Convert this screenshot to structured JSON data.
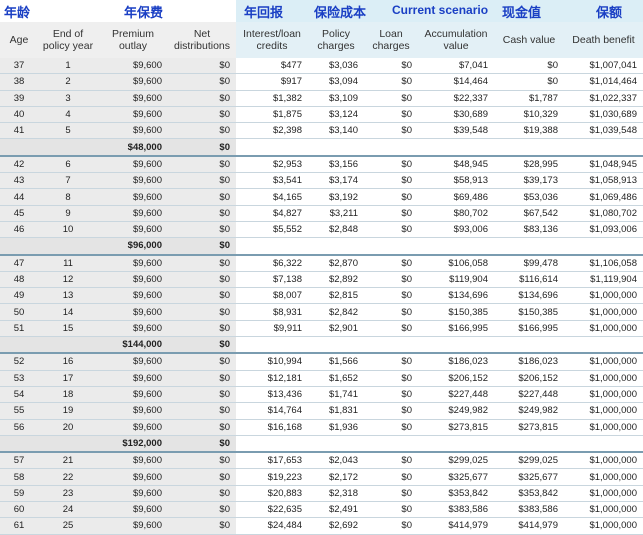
{
  "annotations": {
    "age_cn": "年龄",
    "premium_cn": "年保费",
    "return_cn": "年回报",
    "cost_cn": "保险成本",
    "scenario": "Current scenario",
    "cash_cn": "现金值",
    "coverage_cn": "保额"
  },
  "colors": {
    "annotation_text": "#1a3fc4",
    "band_left": "#ffffff",
    "band_right": "#dbeef6",
    "header_left_bg": "#efefef",
    "header_right_bg": "#e3f0f6"
  },
  "headers": {
    "age": "Age",
    "policy_year": [
      "End of",
      "policy year"
    ],
    "premium": [
      "Premium",
      "outlay"
    ],
    "net_dist": [
      "Net",
      "distributions"
    ],
    "interest": [
      "Interest/loan",
      "credits"
    ],
    "policy_charges": [
      "Policy",
      "charges"
    ],
    "loan_charges": [
      "Loan",
      "charges"
    ],
    "accumulation": [
      "Accumulation",
      "value"
    ],
    "cash": "Cash value",
    "death": "Death benefit"
  },
  "groups": [
    {
      "rows": [
        [
          "37",
          "1",
          "$9,600",
          "$0",
          "$477",
          "$3,036",
          "$0",
          "$7,041",
          "$0",
          "$1,007,041"
        ],
        [
          "38",
          "2",
          "$9,600",
          "$0",
          "$917",
          "$3,094",
          "$0",
          "$14,464",
          "$0",
          "$1,014,464"
        ],
        [
          "39",
          "3",
          "$9,600",
          "$0",
          "$1,382",
          "$3,109",
          "$0",
          "$22,337",
          "$1,787",
          "$1,022,337"
        ],
        [
          "40",
          "4",
          "$9,600",
          "$0",
          "$1,875",
          "$3,124",
          "$0",
          "$30,689",
          "$10,329",
          "$1,030,689"
        ],
        [
          "41",
          "5",
          "$9,600",
          "$0",
          "$2,398",
          "$3,140",
          "$0",
          "$39,548",
          "$19,388",
          "$1,039,548"
        ]
      ],
      "total_premium": "$48,000",
      "total_dist": "$0"
    },
    {
      "rows": [
        [
          "42",
          "6",
          "$9,600",
          "$0",
          "$2,953",
          "$3,156",
          "$0",
          "$48,945",
          "$28,995",
          "$1,048,945"
        ],
        [
          "43",
          "7",
          "$9,600",
          "$0",
          "$3,541",
          "$3,174",
          "$0",
          "$58,913",
          "$39,173",
          "$1,058,913"
        ],
        [
          "44",
          "8",
          "$9,600",
          "$0",
          "$4,165",
          "$3,192",
          "$0",
          "$69,486",
          "$53,036",
          "$1,069,486"
        ],
        [
          "45",
          "9",
          "$9,600",
          "$0",
          "$4,827",
          "$3,211",
          "$0",
          "$80,702",
          "$67,542",
          "$1,080,702"
        ],
        [
          "46",
          "10",
          "$9,600",
          "$0",
          "$5,552",
          "$2,848",
          "$0",
          "$93,006",
          "$83,136",
          "$1,093,006"
        ]
      ],
      "total_premium": "$96,000",
      "total_dist": "$0"
    },
    {
      "rows": [
        [
          "47",
          "11",
          "$9,600",
          "$0",
          "$6,322",
          "$2,870",
          "$0",
          "$106,058",
          "$99,478",
          "$1,106,058"
        ],
        [
          "48",
          "12",
          "$9,600",
          "$0",
          "$7,138",
          "$2,892",
          "$0",
          "$119,904",
          "$116,614",
          "$1,119,904"
        ],
        [
          "49",
          "13",
          "$9,600",
          "$0",
          "$8,007",
          "$2,815",
          "$0",
          "$134,696",
          "$134,696",
          "$1,000,000"
        ],
        [
          "50",
          "14",
          "$9,600",
          "$0",
          "$8,931",
          "$2,842",
          "$0",
          "$150,385",
          "$150,385",
          "$1,000,000"
        ],
        [
          "51",
          "15",
          "$9,600",
          "$0",
          "$9,911",
          "$2,901",
          "$0",
          "$166,995",
          "$166,995",
          "$1,000,000"
        ]
      ],
      "total_premium": "$144,000",
      "total_dist": "$0"
    },
    {
      "rows": [
        [
          "52",
          "16",
          "$9,600",
          "$0",
          "$10,994",
          "$1,566",
          "$0",
          "$186,023",
          "$186,023",
          "$1,000,000"
        ],
        [
          "53",
          "17",
          "$9,600",
          "$0",
          "$12,181",
          "$1,652",
          "$0",
          "$206,152",
          "$206,152",
          "$1,000,000"
        ],
        [
          "54",
          "18",
          "$9,600",
          "$0",
          "$13,436",
          "$1,741",
          "$0",
          "$227,448",
          "$227,448",
          "$1,000,000"
        ],
        [
          "55",
          "19",
          "$9,600",
          "$0",
          "$14,764",
          "$1,831",
          "$0",
          "$249,982",
          "$249,982",
          "$1,000,000"
        ],
        [
          "56",
          "20",
          "$9,600",
          "$0",
          "$16,168",
          "$1,936",
          "$0",
          "$273,815",
          "$273,815",
          "$1,000,000"
        ]
      ],
      "total_premium": "$192,000",
      "total_dist": "$0"
    },
    {
      "rows": [
        [
          "57",
          "21",
          "$9,600",
          "$0",
          "$17,653",
          "$2,043",
          "$0",
          "$299,025",
          "$299,025",
          "$1,000,000"
        ],
        [
          "58",
          "22",
          "$9,600",
          "$0",
          "$19,223",
          "$2,172",
          "$0",
          "$325,677",
          "$325,677",
          "$1,000,000"
        ],
        [
          "59",
          "23",
          "$9,600",
          "$0",
          "$20,883",
          "$2,318",
          "$0",
          "$353,842",
          "$353,842",
          "$1,000,000"
        ],
        [
          "60",
          "24",
          "$9,600",
          "$0",
          "$22,635",
          "$2,491",
          "$0",
          "$383,586",
          "$383,586",
          "$1,000,000"
        ],
        [
          "61",
          "25",
          "$9,600",
          "$0",
          "$24,484",
          "$2,692",
          "$0",
          "$414,979",
          "$414,979",
          "$1,000,000"
        ]
      ]
    }
  ]
}
